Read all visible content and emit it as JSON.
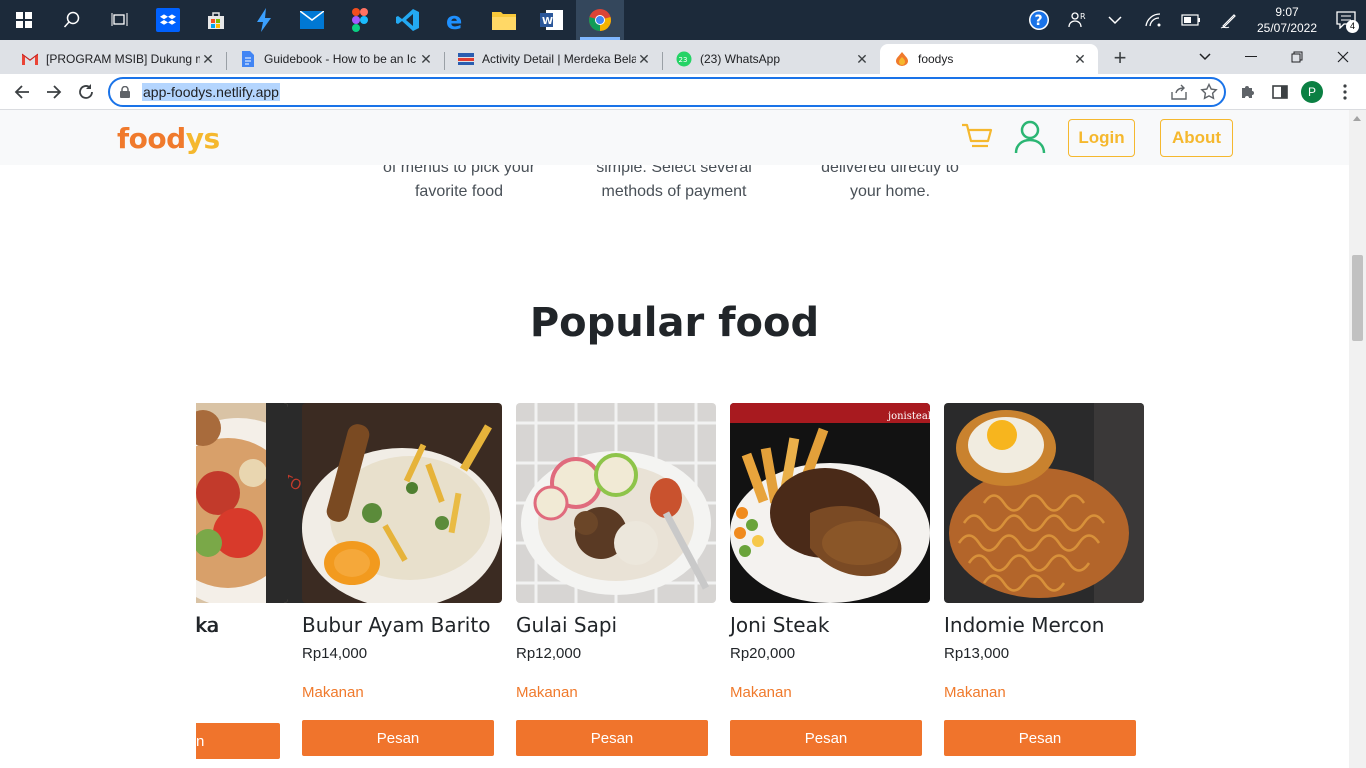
{
  "taskbar": {
    "clock_time": "9:07",
    "clock_date": "25/07/2022",
    "notification_count": "4"
  },
  "tabs": [
    {
      "title": "[PROGRAM MSIB] Dukung m",
      "icon": "gmail-icon"
    },
    {
      "title": "Guidebook - How to be an Ic",
      "icon": "docs-icon"
    },
    {
      "title": "Activity Detail | Merdeka Bela",
      "icon": "kampus-merdeka-icon"
    },
    {
      "title": "(23) WhatsApp",
      "icon": "whatsapp-icon",
      "badge": "23"
    },
    {
      "title": "foodys",
      "icon": "foodys-icon"
    }
  ],
  "address": {
    "url": "app-foodys.netlify.app",
    "profile_initial": "P"
  },
  "site": {
    "brand_part1": "food",
    "brand_part2": "ys",
    "login_label": "Login",
    "about_label": "About",
    "accent": "#f07a2c",
    "accent_yellow": "#f5b82e"
  },
  "steps": [
    {
      "line1": "of menus to pick your",
      "line2": "favorite food"
    },
    {
      "line1": "simple. Select several",
      "line2": "methods of payment"
    },
    {
      "line1": "delivered directly to",
      "line2": "your home."
    }
  ],
  "section": {
    "title": "Popular food"
  },
  "foods": [
    {
      "name": "ka",
      "price": "",
      "category": "",
      "button": "n"
    },
    {
      "name": "Bubur Ayam Barito",
      "price": "Rp14,000",
      "category": "Makanan",
      "button": "Pesan"
    },
    {
      "name": "Gulai Sapi",
      "price": "Rp12,000",
      "category": "Makanan",
      "button": "Pesan"
    },
    {
      "name": "Joni Steak",
      "price": "Rp20,000",
      "category": "Makanan",
      "button": "Pesan",
      "image_text": "jonisteak"
    },
    {
      "name": "Indomie Mercon",
      "price": "Rp13,000",
      "category": "Makanan",
      "button": "Pesan"
    }
  ]
}
